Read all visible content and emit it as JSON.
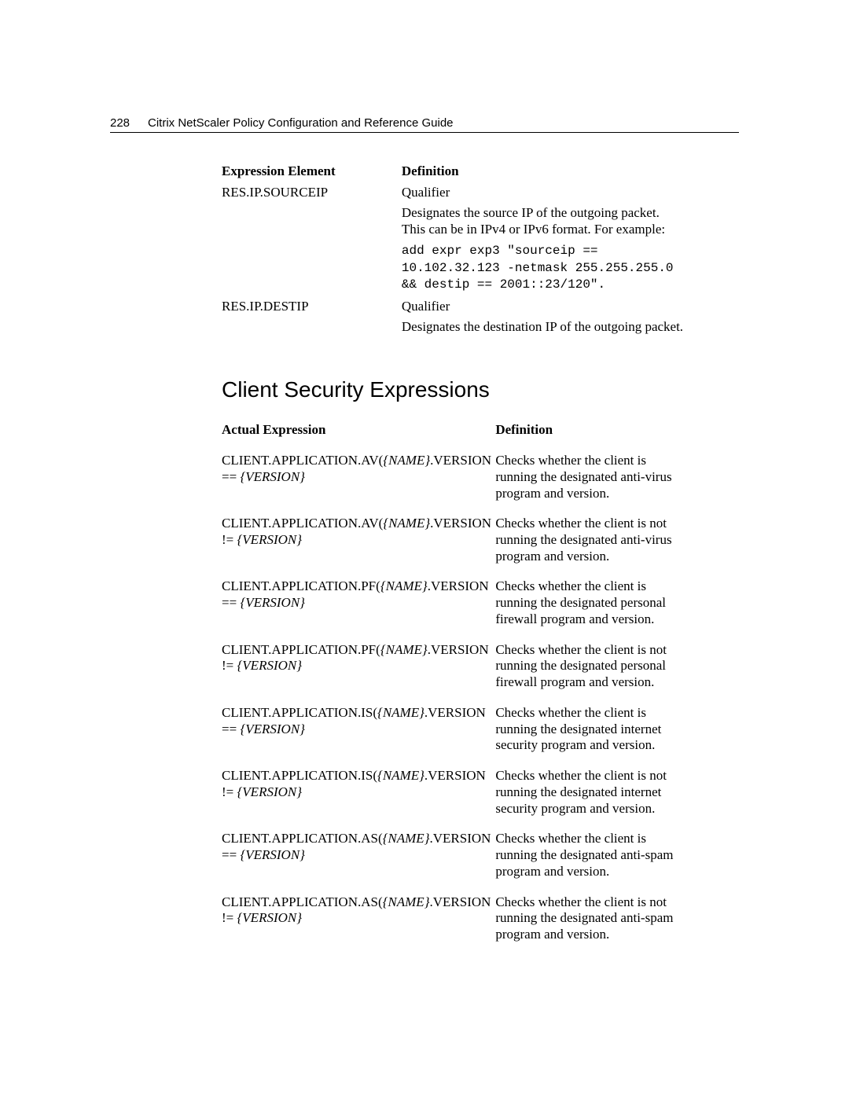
{
  "header": {
    "page_number": "228",
    "doc_title": "Citrix NetScaler Policy Configuration and Reference Guide"
  },
  "table1": {
    "head_expr": "Expression Element",
    "head_def": "Definition",
    "rows": [
      {
        "expr": "RES.IP.SOURCEIP",
        "def1": "Qualifier",
        "def2": "Designates the source IP of the outgoing packet. This can be in IPv4 or IPv6 format. For example:",
        "code": "add expr exp3 \"sourceip == 10.102.32.123 -netmask 255.255.255.0 && destip == 2001::23/120\"."
      },
      {
        "expr": "RES.IP.DESTIP",
        "def1": "Qualifier",
        "def2": "Designates the destination IP of the outgoing packet."
      }
    ]
  },
  "section_heading": "Client Security Expressions",
  "table2": {
    "head_expr": "Actual Expression",
    "head_def": "Definition",
    "rows": [
      {
        "pre": "CLIENT.APPLICATION.AV(",
        "nm": "{NAME}",
        "mid_op": ".VERSION == ",
        "ver": "{VERSION}",
        "post": "",
        "def": "Checks whether the client is running the designated anti-virus program and version."
      },
      {
        "pre": "CLIENT.APPLICATION.AV(",
        "nm": "{NAME}",
        "mid_op": ".VERSION != ",
        "ver": "{VERSION}",
        "post": "",
        "def": "Checks whether the client is not running the designated anti-virus program and version."
      },
      {
        "pre": "CLIENT.APPLICATION.PF(",
        "nm": "{NAME}",
        "mid_op": ".VERSION == ",
        "ver": "{VERSION}",
        "post": "",
        "def": "Checks whether the client is running the designated personal firewall program and version."
      },
      {
        "pre": "CLIENT.APPLICATION.PF(",
        "nm": "{NAME}",
        "mid_op": ".VERSION != ",
        "ver": "{VERSION}",
        "post": "",
        "def": "Checks whether the client is not running the designated personal firewall program and version."
      },
      {
        "pre": "CLIENT.APPLICATION.IS(",
        "nm": "{NAME}",
        "mid_op": ".VERSION == ",
        "ver": "{VERSION}",
        "post": "",
        "def": "Checks whether the client is running the designated internet security program and version."
      },
      {
        "pre": "CLIENT.APPLICATION.IS(",
        "nm": "{NAME}",
        "mid_op": ".VERSION != ",
        "ver": "{VERSION}",
        "post": "",
        "def": "Checks whether the client is not running the designated internet security program and version."
      },
      {
        "pre": "CLIENT.APPLICATION.AS(",
        "nm": "{NAME}",
        "mid_op": ".VERSION == ",
        "ver": "{VERSION}",
        "post": "",
        "def": "Checks whether the client is running the designated anti-spam program and version."
      },
      {
        "pre": "CLIENT.APPLICATION.AS(",
        "nm": "{NAME}",
        "mid_op": ".VERSION != ",
        "ver": "{VERSION}",
        "post": "",
        "def": "Checks whether the client is not running the designated anti-spam program and version."
      }
    ]
  }
}
